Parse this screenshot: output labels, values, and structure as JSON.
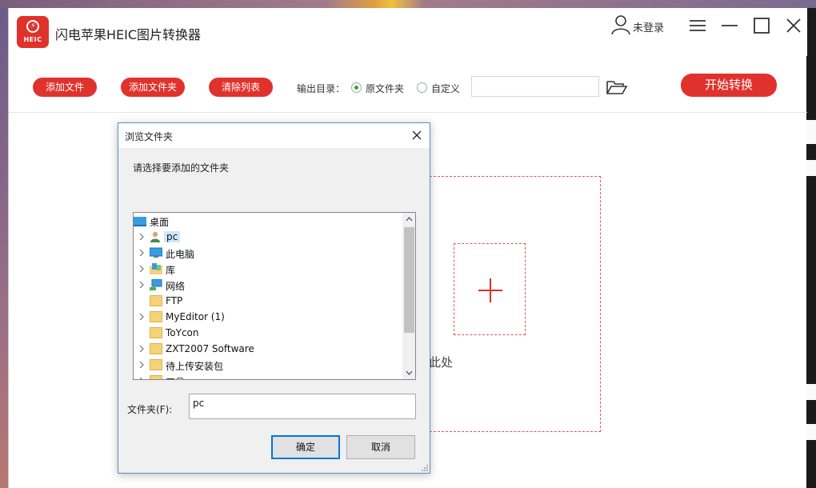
{
  "app": {
    "title": "闪电苹果HEIC图片转换器",
    "logo_text": "HEIC",
    "user_status": "未登录"
  },
  "toolbar": {
    "add_file": "添加文件",
    "add_folder": "添加文件夹",
    "clear_list": "清除列表",
    "output_label": "输出目录：",
    "option_original": "原文件夹",
    "option_custom": "自定义",
    "selected_option": "原文件夹",
    "path_value": "",
    "start": "开始转换"
  },
  "dropzone": {
    "hint": "拖拽文件到此处",
    "hint_visible": "拽文件到此处"
  },
  "dialog": {
    "title": "浏览文件夹",
    "prompt": "请选择要添加的文件夹",
    "tree": [
      {
        "label": "桌面",
        "icon": "desktop-icon",
        "expandable": false,
        "level": 0,
        "selected": false
      },
      {
        "label": "pc",
        "icon": "user-folder-icon",
        "expandable": true,
        "level": 1,
        "selected": true
      },
      {
        "label": "此电脑",
        "icon": "computer-icon",
        "expandable": true,
        "level": 1,
        "selected": false
      },
      {
        "label": "库",
        "icon": "library-icon",
        "expandable": true,
        "level": 1,
        "selected": false
      },
      {
        "label": "网络",
        "icon": "network-icon",
        "expandable": true,
        "level": 1,
        "selected": false
      },
      {
        "label": "FTP",
        "icon": "folder-icon",
        "expandable": false,
        "level": 1,
        "selected": false
      },
      {
        "label": "MyEditor (1)",
        "icon": "folder-icon",
        "expandable": true,
        "level": 1,
        "selected": false
      },
      {
        "label": "ToYcon",
        "icon": "folder-icon",
        "expandable": false,
        "level": 1,
        "selected": false
      },
      {
        "label": "ZXT2007 Software",
        "icon": "folder-icon",
        "expandable": true,
        "level": 1,
        "selected": false
      },
      {
        "label": "待上传安装包",
        "icon": "folder-icon",
        "expandable": true,
        "level": 1,
        "selected": false
      },
      {
        "label": "工具",
        "icon": "folder-icon",
        "expandable": true,
        "level": 1,
        "selected": false
      }
    ],
    "folder_label": "文件夹(F):",
    "folder_value": "pc",
    "ok": "确定",
    "cancel": "取消"
  },
  "colors": {
    "accent": "#e0322c",
    "dialog_border": "#5a8ec9",
    "selection": "#cce8ff"
  }
}
